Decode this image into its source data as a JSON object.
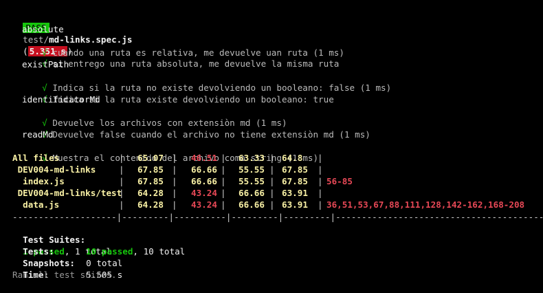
{
  "header": {
    "badge": "PASS",
    "path_dir": "test/",
    "path_file": "md-links.spec.js",
    "open_paren": "(",
    "duration": "5.351 s",
    "close_paren": ")"
  },
  "suites": [
    {
      "name": "absolute",
      "tests": [
        {
          "check": "√",
          "text": "cuando una ruta es relativa, me devuelve uan ruta (1 ms)"
        },
        {
          "check": "√",
          "text": "si entrego una ruta absoluta, me devuelve la misma ruta"
        }
      ]
    },
    {
      "name": "existPath",
      "tests": [
        {
          "check": "√",
          "text": "Indica si la ruta no existe devolviendo un booleano: false (1 ms)"
        },
        {
          "check": "√",
          "text": "Indica si la ruta existe devolviendo un booleano: true"
        }
      ]
    },
    {
      "name": "identificatorMd",
      "tests": [
        {
          "check": "√",
          "text": "Devuelve los archivos con extensiòn md (1 ms)"
        },
        {
          "check": "√",
          "text": "Devuelve false cuando el archivo no tiene extensiòn md (1 ms)"
        }
      ]
    },
    {
      "name": "readMd",
      "tests": [
        {
          "check": "√",
          "text": "Muestra el contenido del archivo como string (1 ms)"
        }
      ]
    }
  ],
  "coverage": {
    "rows": [
      {
        "file": "All files",
        "stmts": "65.07",
        "branch": "46.51",
        "funcs": "63.33",
        "lines": "64.8",
        "uncovered": "",
        "colors": {
          "stmts": "#f9f1a5",
          "branch": "#e74856",
          "funcs": "#f9f1a5",
          "lines": "#f9f1a5",
          "file": "#f9f1a5"
        }
      },
      {
        "file": " DEV004-md-links",
        "stmts": "67.85",
        "branch": "66.66",
        "funcs": "55.55",
        "lines": "67.85",
        "uncovered": "",
        "colors": {
          "stmts": "#f9f1a5",
          "branch": "#f9f1a5",
          "funcs": "#f9f1a5",
          "lines": "#f9f1a5",
          "file": "#f9f1a5"
        }
      },
      {
        "file": "  index.js",
        "stmts": "67.85",
        "branch": "66.66",
        "funcs": "55.55",
        "lines": "67.85",
        "uncovered": "56-85",
        "colors": {
          "stmts": "#f9f1a5",
          "branch": "#f9f1a5",
          "funcs": "#f9f1a5",
          "lines": "#f9f1a5",
          "file": "#f9f1a5"
        }
      },
      {
        "file": " DEV004-md-links/test",
        "stmts": "64.28",
        "branch": "43.24",
        "funcs": "66.66",
        "lines": "63.91",
        "uncovered": "",
        "colors": {
          "stmts": "#f9f1a5",
          "branch": "#e74856",
          "funcs": "#f9f1a5",
          "lines": "#f9f1a5",
          "file": "#f9f1a5"
        }
      },
      {
        "file": "  data.js",
        "stmts": "64.28",
        "branch": "43.24",
        "funcs": "66.66",
        "lines": "63.91",
        "uncovered": "36,51,53,67,88,111,128,142-162,168-208",
        "colors": {
          "stmts": "#f9f1a5",
          "branch": "#e74856",
          "funcs": "#f9f1a5",
          "lines": "#f9f1a5",
          "file": "#f9f1a5"
        }
      }
    ],
    "separator": "--------------------|---------|----------|---------|---------|-------------------------------------------"
  },
  "summary": {
    "suites_label": "Test Suites:",
    "suites_passed": "1 passed",
    "suites_total": ", 1 total",
    "tests_label": "Tests:",
    "tests_passed": "10 passed",
    "tests_total": ", 10 total",
    "snapshots_label": "Snapshots:",
    "snapshots_value": "0 total",
    "time_label": "Time:",
    "time_value": "5.505 s",
    "footer": "Ran all test suites."
  }
}
